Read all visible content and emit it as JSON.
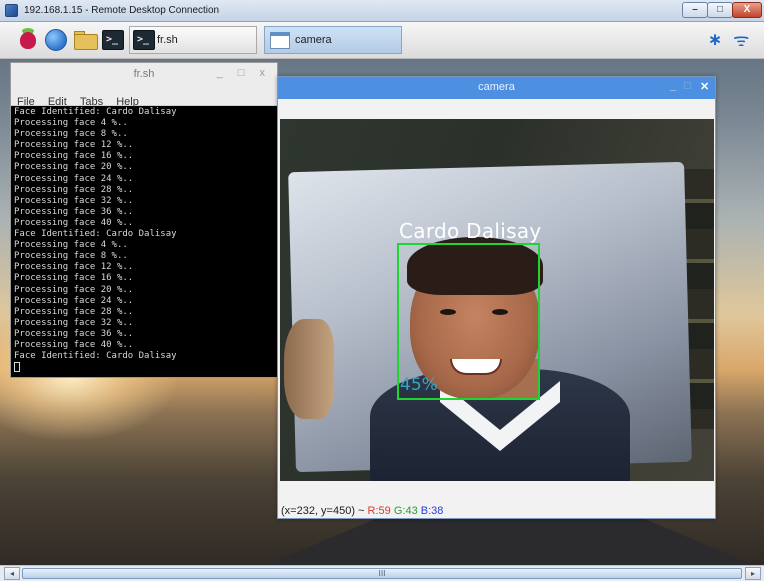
{
  "rdp": {
    "title": "192.168.1.15 - Remote Desktop Connection",
    "min_label": "–",
    "max_label": "□",
    "close_label": "X"
  },
  "taskbar": {
    "tasks": [
      {
        "label": "fr.sh",
        "icon": "terminal-icon"
      },
      {
        "label": "camera",
        "icon": "camera-window-icon"
      }
    ],
    "launcher_terminal_glyph": ">_",
    "bluetooth_glyph": "∗",
    "wifi_glyph": "ᯤ"
  },
  "terminal": {
    "title": "fr.sh",
    "controls": "_ □ x",
    "menu": [
      "File",
      "Edit",
      "Tabs",
      "Help"
    ],
    "lines": [
      "Face Identified: Cardo Dalisay",
      "Processing face 4 %..",
      "Processing face 8 %..",
      "Processing face 12 %..",
      "Processing face 16 %..",
      "Processing face 20 %..",
      "Processing face 24 %..",
      "Processing face 28 %..",
      "Processing face 32 %..",
      "Processing face 36 %..",
      "Processing face 40 %..",
      "Face Identified: Cardo Dalisay",
      "Processing face 4 %..",
      "Processing face 8 %..",
      "Processing face 12 %..",
      "Processing face 16 %..",
      "Processing face 20 %..",
      "Processing face 24 %..",
      "Processing face 28 %..",
      "Processing face 32 %..",
      "Processing face 36 %..",
      "Processing face 40 %..",
      "Face Identified: Cardo Dalisay"
    ]
  },
  "camera": {
    "title": "camera",
    "min_label": "_",
    "max_label": "□",
    "close_label": "✕",
    "detection_name": "Cardo Dalisay",
    "detection_confidence": "45%",
    "status_coords": "(x=232, y=450) ~",
    "status_r": "R:59",
    "status_g": "G:43",
    "status_b": "B:38",
    "colors": {
      "box": "#20d432",
      "confidence": "#34a6c2",
      "titlebar": "#4d90e2"
    }
  },
  "scrollbar": {
    "left_arrow": "◂",
    "right_arrow": "▸",
    "thumb_grip": "III"
  }
}
